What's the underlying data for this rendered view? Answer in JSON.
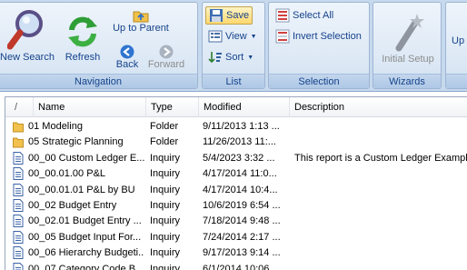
{
  "ribbon": {
    "navigation": {
      "label": "Navigation",
      "new_search": "New Search",
      "refresh": "Refresh",
      "up_to_parent": "Up to Parent",
      "back": "Back",
      "forward": "Forward"
    },
    "list": {
      "label": "List",
      "save": "Save",
      "view": "View",
      "sort": "Sort"
    },
    "selection": {
      "label": "Selection",
      "select_all": "Select All",
      "invert_selection": "Invert Selection"
    },
    "wizards": {
      "label": "Wizards",
      "initial_setup": "Initial Setup"
    },
    "partial": {
      "label": "Up"
    }
  },
  "list": {
    "columns": {
      "sort_indicator": "/",
      "name": "Name",
      "type": "Type",
      "modified": "Modified",
      "description": "Description"
    },
    "rows": [
      {
        "icon": "folder-icon",
        "name": "01 Modeling",
        "type": "Folder",
        "modified": "9/11/2013 1:13 ...",
        "description": ""
      },
      {
        "icon": "folder-icon",
        "name": "05 Strategic Planning",
        "type": "Folder",
        "modified": "11/26/2013 11:...",
        "description": ""
      },
      {
        "icon": "document-icon",
        "name": "00_00 Custom Ledger E...",
        "type": "Inquiry",
        "modified": "5/4/2023 3:32 ...",
        "description": "This report is a Custom Ledger Example"
      },
      {
        "icon": "document-icon",
        "name": "00_00.01.00 P&L",
        "type": "Inquiry",
        "modified": "4/17/2014 11:0...",
        "description": ""
      },
      {
        "icon": "document-icon",
        "name": "00_00.01.01 P&L by BU",
        "type": "Inquiry",
        "modified": "4/17/2014 10:4...",
        "description": ""
      },
      {
        "icon": "document-icon",
        "name": "00_02 Budget Entry",
        "type": "Inquiry",
        "modified": "10/6/2019 6:54 ...",
        "description": ""
      },
      {
        "icon": "document-icon",
        "name": "00_02.01 Budget Entry ...",
        "type": "Inquiry",
        "modified": "7/18/2014 9:48 ...",
        "description": ""
      },
      {
        "icon": "document-icon",
        "name": "00_05 Budget Input For...",
        "type": "Inquiry",
        "modified": "7/24/2014 2:17 ...",
        "description": ""
      },
      {
        "icon": "document-icon",
        "name": "00_06 Hierarchy Budgeti...",
        "type": "Inquiry",
        "modified": "9/17/2013 9:14 ...",
        "description": ""
      },
      {
        "icon": "document-icon",
        "name": "00_07 Category Code B...",
        "type": "Inquiry",
        "modified": "6/1/2014 10:06 ...",
        "description": ""
      }
    ]
  }
}
